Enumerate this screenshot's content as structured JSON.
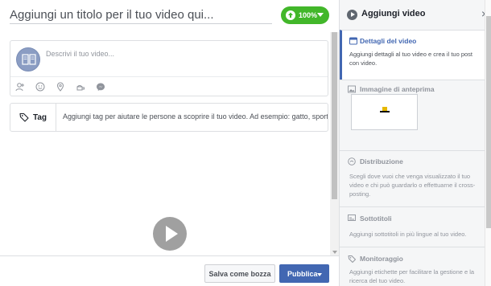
{
  "editor": {
    "title_placeholder": "Aggiungi un titolo per il tuo video qui...",
    "upload_progress": "100%",
    "description_placeholder": "Descrivi il tuo video...",
    "tag_label": "Tag",
    "tag_placeholder": "Aggiungi tag per aiutare le persone a scoprire il tuo video. Ad esempio: gatto, sport,"
  },
  "footer": {
    "save_draft_label": "Salva come bozza",
    "publish_label": "Pubblica"
  },
  "sidebar": {
    "title": "Aggiungi video",
    "close_glyph": "×",
    "sections": [
      {
        "title": "Dettagli del video",
        "description": "Aggiungi dettagli al tuo video e crea il tuo post con video.",
        "active": true
      },
      {
        "title": "Immagine di anteprima",
        "description": "",
        "active": false
      },
      {
        "title": "Distribuzione",
        "description": "Scegli dove vuoi che venga visualizzato il tuo video e chi può guardarlo o effettuarne il cross-posting.",
        "active": false
      },
      {
        "title": "Sottotitoli",
        "description": "Aggiungi sottotitoli in più lingue al tuo video.",
        "active": false
      },
      {
        "title": "Monitoraggio",
        "description": "Aggiungi etichette per facilitare la gestione e la ricerca del tuo video.",
        "active": false
      }
    ]
  },
  "colors": {
    "accent": "#4267b2",
    "upload_green": "#42b72a",
    "sidebar_bg": "#f5f6f7"
  },
  "icons": [
    "upload-icon",
    "book-icon",
    "tag-person-icon",
    "emoji-icon",
    "location-icon",
    "activity-icon",
    "messenger-icon",
    "price-tag-icon",
    "play-icon",
    "video-details-icon",
    "image-icon",
    "distribution-icon",
    "subtitles-icon",
    "monitoring-icon"
  ]
}
